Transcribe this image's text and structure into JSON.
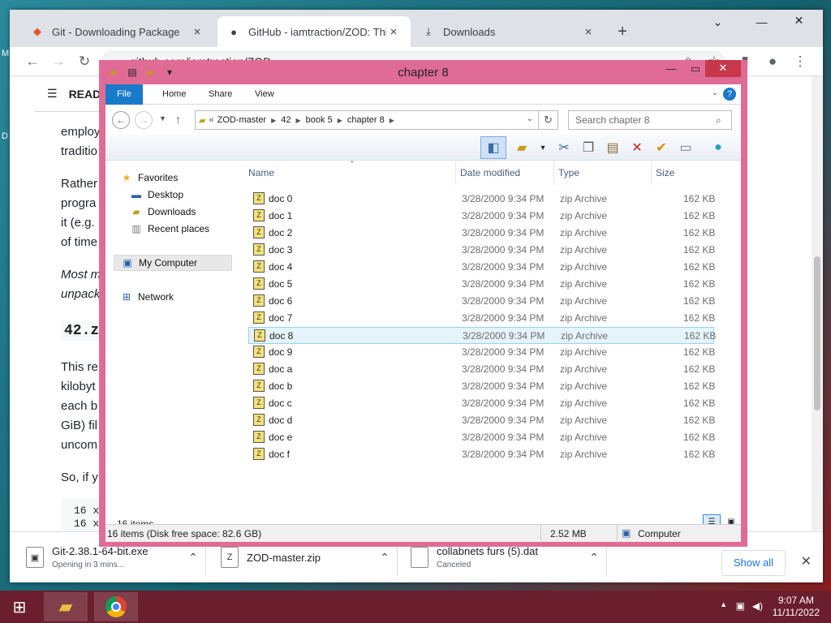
{
  "chrome": {
    "tabs": [
      {
        "title": "Git - Downloading Package",
        "icon": "git-icon"
      },
      {
        "title": "GitHub - iamtraction/ZOD: This i",
        "icon": "github-icon"
      },
      {
        "title": "Downloads",
        "icon": "download-icon"
      }
    ],
    "url": "github.com/iamtraction/ZOD",
    "page": {
      "readme_label": "READ",
      "lines": [
        "employ",
        "traditio",
        "Rather",
        "progra",
        "it (e.g.",
        "of time",
        "Most m",
        "unpack",
        "This re",
        "kilobyt",
        "each b",
        "GiB) fil",
        "uncom",
        "So, if y"
      ],
      "heading": "42.z",
      "code": [
        "16 x",
        "16 x"
      ]
    },
    "downloads": [
      {
        "name": "Git-2.38.1-64-bit.exe",
        "status": "Opening in 3 mins..."
      },
      {
        "name": "ZOD-master.zip",
        "status": ""
      },
      {
        "name": "collabnets furs (5).dat",
        "status": "Canceled"
      }
    ],
    "show_all": "Show all"
  },
  "explorer": {
    "title": "chapter 8",
    "ribbon_tabs": [
      "File",
      "Home",
      "Share",
      "View"
    ],
    "breadcrumb": [
      "ZOD-master",
      "42",
      "book 5",
      "chapter 8"
    ],
    "search_placeholder": "Search chapter 8",
    "nav": {
      "favorites": "Favorites",
      "desktop": "Desktop",
      "downloads": "Downloads",
      "recent": "Recent places",
      "my_computer": "My Computer",
      "network": "Network"
    },
    "columns": {
      "name": "Name",
      "date": "Date modified",
      "type": "Type",
      "size": "Size"
    },
    "files": [
      {
        "name": "doc 0",
        "date": "3/28/2000 9:34 PM",
        "type": "zip Archive",
        "size": "162 KB"
      },
      {
        "name": "doc 1",
        "date": "3/28/2000 9:34 PM",
        "type": "zip Archive",
        "size": "162 KB"
      },
      {
        "name": "doc 2",
        "date": "3/28/2000 9:34 PM",
        "type": "zip Archive",
        "size": "162 KB"
      },
      {
        "name": "doc 3",
        "date": "3/28/2000 9:34 PM",
        "type": "zip Archive",
        "size": "162 KB"
      },
      {
        "name": "doc 4",
        "date": "3/28/2000 9:34 PM",
        "type": "zip Archive",
        "size": "162 KB"
      },
      {
        "name": "doc 5",
        "date": "3/28/2000 9:34 PM",
        "type": "zip Archive",
        "size": "162 KB"
      },
      {
        "name": "doc 6",
        "date": "3/28/2000 9:34 PM",
        "type": "zip Archive",
        "size": "162 KB"
      },
      {
        "name": "doc 7",
        "date": "3/28/2000 9:34 PM",
        "type": "zip Archive",
        "size": "162 KB"
      },
      {
        "name": "doc 8",
        "date": "3/28/2000 9:34 PM",
        "type": "zip Archive",
        "size": "162 KB",
        "selected": true
      },
      {
        "name": "doc 9",
        "date": "3/28/2000 9:34 PM",
        "type": "zip Archive",
        "size": "162 KB"
      },
      {
        "name": "doc a",
        "date": "3/28/2000 9:34 PM",
        "type": "zip Archive",
        "size": "162 KB"
      },
      {
        "name": "doc b",
        "date": "3/28/2000 9:34 PM",
        "type": "zip Archive",
        "size": "162 KB"
      },
      {
        "name": "doc c",
        "date": "3/28/2000 9:34 PM",
        "type": "zip Archive",
        "size": "162 KB"
      },
      {
        "name": "doc d",
        "date": "3/28/2000 9:34 PM",
        "type": "zip Archive",
        "size": "162 KB"
      },
      {
        "name": "doc e",
        "date": "3/28/2000 9:34 PM",
        "type": "zip Archive",
        "size": "162 KB"
      },
      {
        "name": "doc f",
        "date": "3/28/2000 9:34 PM",
        "type": "zip Archive",
        "size": "162 KB"
      }
    ],
    "item_count": "16 items",
    "status_left": "16 items (Disk free space: 82.6 GB)",
    "status_size": "2.52 MB",
    "status_location": "Computer"
  },
  "taskbar": {
    "time": "9:07 AM",
    "date": "11/11/2022"
  },
  "colors": {
    "explorer_frame": "#e06c95",
    "taskbar": "#6b1e2d",
    "file_tab": "#1979ca",
    "selection": "#e5f3fb"
  }
}
